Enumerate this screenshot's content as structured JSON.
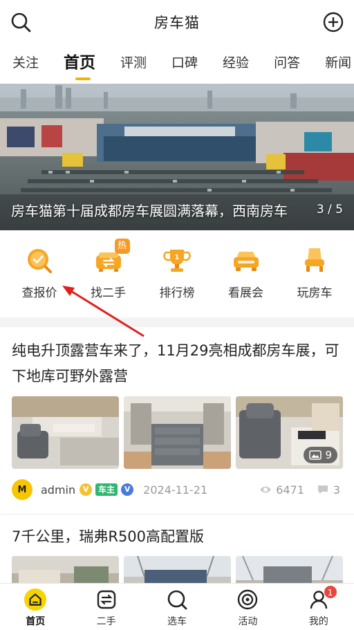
{
  "header": {
    "title": "房车猫",
    "search_icon": "search-icon",
    "add_icon": "plus-circle-icon"
  },
  "tabs": [
    {
      "label": "关注",
      "active": false
    },
    {
      "label": "首页",
      "active": true
    },
    {
      "label": "评测",
      "active": false
    },
    {
      "label": "口碑",
      "active": false
    },
    {
      "label": "经验",
      "active": false
    },
    {
      "label": "问答",
      "active": false
    },
    {
      "label": "新闻",
      "active": false
    }
  ],
  "banner": {
    "caption": "房车猫第十届成都房车展圆满落幕，西南房车",
    "pager": "3 / 5"
  },
  "quicknav": [
    {
      "label": "查报价",
      "icon": "search-price-icon"
    },
    {
      "label": "找二手",
      "icon": "used-car-icon",
      "badge": "热"
    },
    {
      "label": "排行榜",
      "icon": "trophy-icon"
    },
    {
      "label": "看展会",
      "icon": "expo-car-icon"
    },
    {
      "label": "玩房车",
      "icon": "seat-icon"
    }
  ],
  "article1": {
    "title": "纯电升顶露营车来了，11月29亮相成都房车展，可下地库可野外露营",
    "photo_count": "9",
    "author": "admin",
    "avatar_text": "M",
    "owner_badge": "车主",
    "v_badge": "V",
    "date": "2024-11-21",
    "views": "6471",
    "comments": "3"
  },
  "article2": {
    "title": "7千公里，瑞弗R500高配置版"
  },
  "bottomnav": [
    {
      "label": "首页",
      "icon": "home-icon",
      "active": true
    },
    {
      "label": "二手",
      "icon": "used-icon",
      "active": false
    },
    {
      "label": "选车",
      "icon": "search-car-icon",
      "active": false
    },
    {
      "label": "活动",
      "icon": "target-icon",
      "active": false
    },
    {
      "label": "我的",
      "icon": "user-icon",
      "active": false,
      "badge": "1"
    }
  ],
  "colors": {
    "accent": "#f6b400",
    "annotation": "#e02020"
  }
}
